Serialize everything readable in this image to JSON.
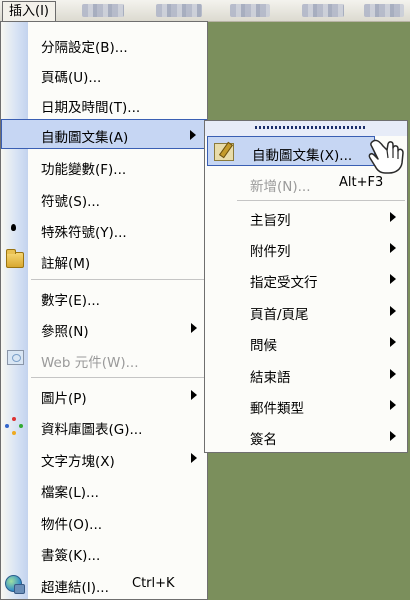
{
  "menubar": {
    "insert_label": "插入(I)"
  },
  "insert_menu": {
    "items": [
      {
        "label": "分隔設定(B)..."
      },
      {
        "label": "頁碼(U)..."
      },
      {
        "label": "日期及時間(T)..."
      },
      {
        "label": "自動圖文集(A)"
      },
      {
        "label": "功能變數(F)..."
      },
      {
        "label": "符號(S)..."
      },
      {
        "label": "特殊符號(Y)..."
      },
      {
        "label": "註解(M)"
      },
      {
        "label": "數字(E)..."
      },
      {
        "label": "參照(N)"
      },
      {
        "label": "Web 元件(W)..."
      },
      {
        "label": "圖片(P)"
      },
      {
        "label": "資料庫圖表(G)..."
      },
      {
        "label": "文字方塊(X)"
      },
      {
        "label": "檔案(L)..."
      },
      {
        "label": "物件(O)..."
      },
      {
        "label": "書簽(K)..."
      },
      {
        "label": "超連結(I)...",
        "shortcut": "Ctrl+K"
      }
    ]
  },
  "autotext_submenu": {
    "items": [
      {
        "label": "自動圖文集(X)..."
      },
      {
        "label": "新增(N)...",
        "shortcut": "Alt+F3"
      },
      {
        "label": "主旨列"
      },
      {
        "label": "附件列"
      },
      {
        "label": "指定受文行"
      },
      {
        "label": "頁首/頁尾"
      },
      {
        "label": "問候"
      },
      {
        "label": "結束語"
      },
      {
        "label": "郵件類型"
      },
      {
        "label": "簽名"
      }
    ]
  },
  "colors": {
    "highlight_bg": "#c6d6f3",
    "highlight_border": "#3a5fb3",
    "document_bg": "#7b8f5c",
    "disabled_text": "#9a9a9a"
  }
}
